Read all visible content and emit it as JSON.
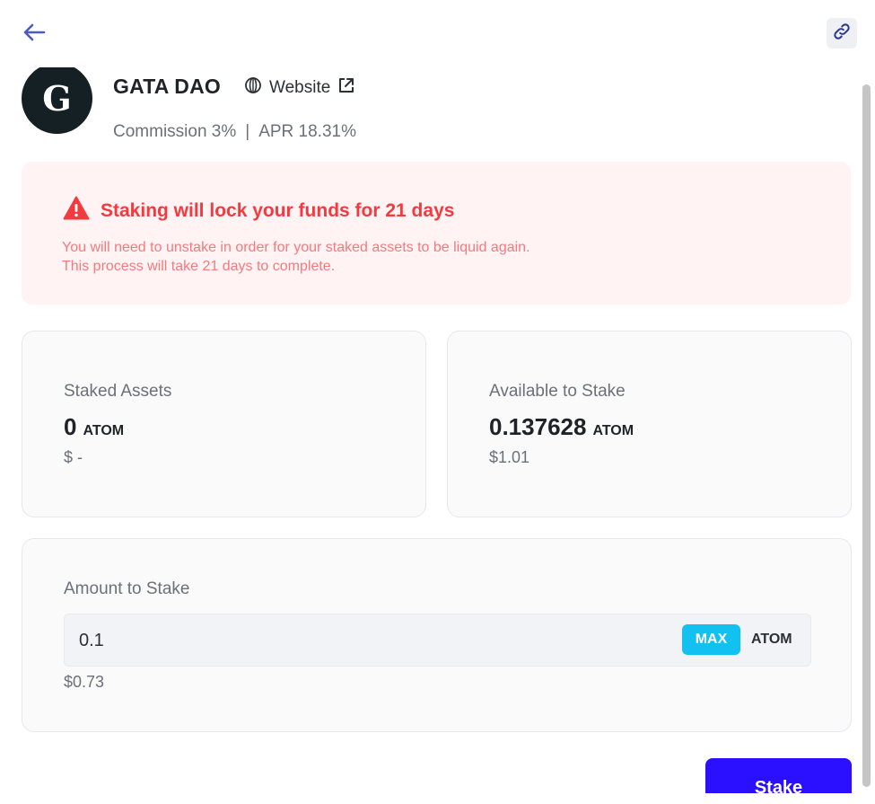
{
  "header": {
    "back_icon": "arrow-left-icon",
    "link_icon": "link-icon",
    "accent_color": "#4a5cc4"
  },
  "validator": {
    "avatar_letter": "G",
    "name": "GATA DAO",
    "website_label": "Website",
    "website_icon": "globe-icon",
    "external_icon": "external-link-icon",
    "commission": "Commission 3%",
    "separator": "|",
    "apr": "APR 18.31%"
  },
  "warning": {
    "icon": "warning-triangle-icon",
    "title": "Staking will lock your funds for 21 days",
    "line1": "You will need to unstake in order for your staked assets to be liquid again.",
    "line2": "This process will take 21 days to complete.",
    "color": "#f23a3f"
  },
  "staked": {
    "label": "Staked Assets",
    "amount": "0",
    "unit": "ATOM",
    "usd": "$ -"
  },
  "available": {
    "label": "Available to Stake",
    "amount": "0.137628",
    "unit": "ATOM",
    "usd": "$1.01"
  },
  "amount_to_stake": {
    "label": "Amount to Stake",
    "value": "0.1",
    "max_label": "MAX",
    "unit": "ATOM",
    "usd": "$0.73",
    "max_color": "#13c1f0"
  },
  "actions": {
    "stake_label": "Stake",
    "stake_color": "#2b10ff"
  }
}
